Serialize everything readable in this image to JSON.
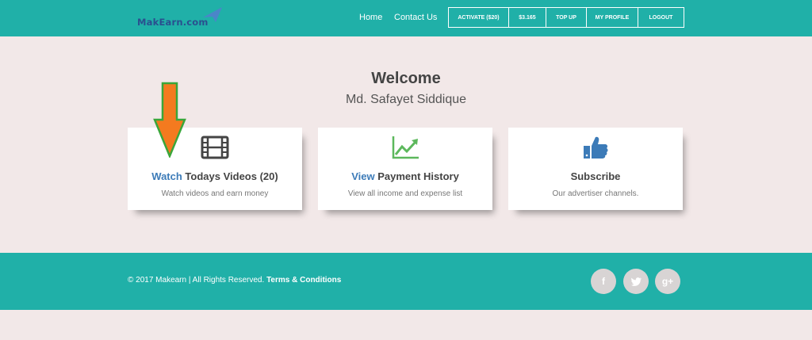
{
  "header": {
    "logo_text": "MakEarn.com",
    "nav_links": [
      "Home",
      "Contact Us"
    ],
    "buttons": [
      {
        "label": "ACTIVATE ($20)"
      },
      {
        "label": "$3.165"
      },
      {
        "label": "TOP UP"
      },
      {
        "label": "MY PROFILE"
      },
      {
        "label": "LOGOUT"
      }
    ]
  },
  "welcome": {
    "title": "Welcome",
    "name": "Md. Safayet Siddique"
  },
  "cards": [
    {
      "highlight": "Watch",
      "title": " Todays Videos (20)",
      "desc": "Watch videos and earn money",
      "icon": "film-icon"
    },
    {
      "highlight": "View",
      "title": " Payment History",
      "desc": "View all income and expense list",
      "icon": "chart-line-icon"
    },
    {
      "highlight": "",
      "title": "Subscribe",
      "desc": "Our advertiser channels.",
      "icon": "thumbs-up-icon"
    }
  ],
  "footer": {
    "copyright": "© 2017 Makearn | All Rights Reserved.",
    "terms": "Terms & Conditions",
    "social": [
      "f",
      "t",
      "g+"
    ]
  },
  "colors": {
    "brand": "#20b0a8",
    "link": "#3c7bb8",
    "background": "#f2e8e8",
    "annotation_arrow": "#f47a1f"
  }
}
